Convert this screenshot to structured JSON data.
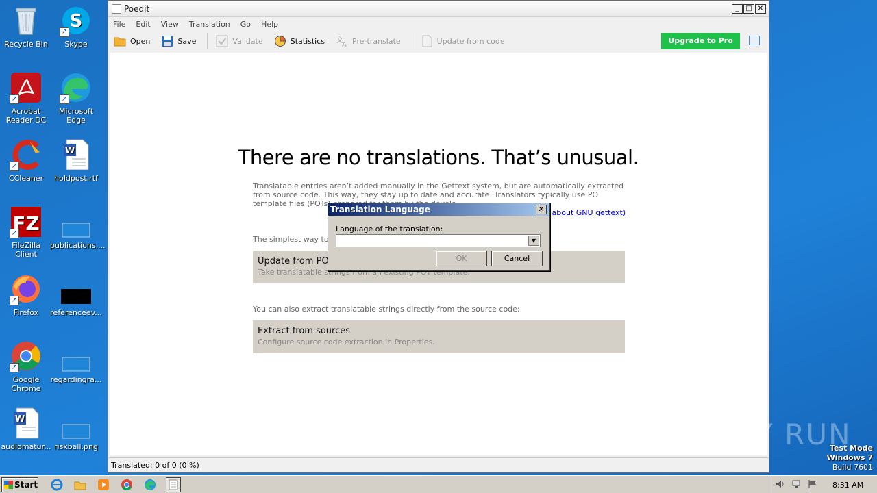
{
  "desktop": {
    "icons": [
      {
        "label": "Recycle Bin"
      },
      {
        "label": "Skype"
      },
      {
        "label": "Acrobat Reader DC"
      },
      {
        "label": "Microsoft Edge"
      },
      {
        "label": "CCleaner"
      },
      {
        "label": "holdpost.rtf"
      },
      {
        "label": "FileZilla Client"
      },
      {
        "label": "publications...."
      },
      {
        "label": "Firefox"
      },
      {
        "label": "referenceev..."
      },
      {
        "label": "Google Chrome"
      },
      {
        "label": "regardingra..."
      },
      {
        "label": "audiomatur..."
      },
      {
        "label": "riskball.png"
      }
    ],
    "watermark": "ANY RUN",
    "testmode": {
      "line1": "Test Mode",
      "line2": "Windows 7",
      "line3": "Build 7601"
    }
  },
  "window": {
    "title": "Poedit",
    "menu": [
      "File",
      "Edit",
      "View",
      "Translation",
      "Go",
      "Help"
    ],
    "toolbar": {
      "open": "Open",
      "save": "Save",
      "validate": "Validate",
      "statistics": "Statistics",
      "pretranslate": "Pre-translate",
      "update_from_code": "Update from code",
      "upgrade": "Upgrade to Pro"
    },
    "content": {
      "headline": "There are no translations. That’s unusual.",
      "para1": "Translatable entries aren’t added manually in the Gettext system, but are automatically extracted from source code. This way, they stay up to date and accurate. Translators typically use PO template files (POTs) prepared for them by the develc",
      "learn_more": "re about GNU gettext)",
      "para2": "The simplest way to fill",
      "pot_title": "Update from POT",
      "pot_sub": "Take translatable strings from an existing POT template.",
      "para3": "You can also extract translatable strings directly from the source code:",
      "extract_title": "Extract from sources",
      "extract_sub": "Configure source code extraction in Properties."
    },
    "status": "Translated: 0 of 0 (0 %)"
  },
  "dialog": {
    "title": "Translation Language",
    "label": "Language of the translation:",
    "value": "",
    "ok": "OK",
    "cancel": "Cancel"
  },
  "taskbar": {
    "start": "Start",
    "clock": "8:31 AM"
  },
  "colors": {
    "upgrade": "#1ec14a",
    "desktop": "#1d7bd0",
    "panel": "#d4d0c8"
  }
}
